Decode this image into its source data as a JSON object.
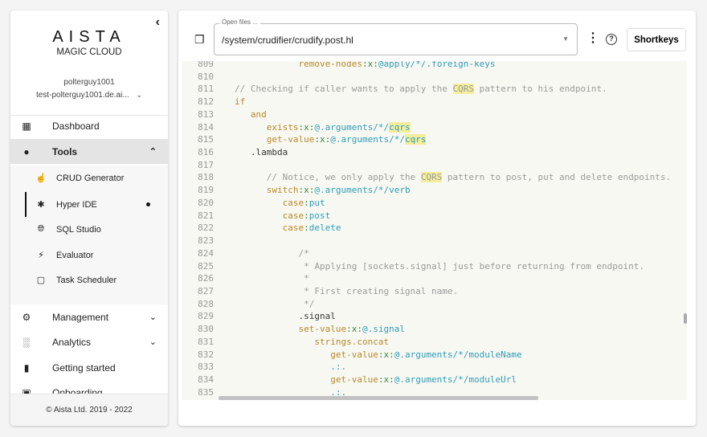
{
  "sidebar": {
    "brand": "AISTA",
    "subtitle": "MAGIC CLOUD",
    "username": "polterguy1001",
    "cloudlet": "test-polterguy1001.de.ai...",
    "nav": [
      {
        "label": "Dashboard",
        "icon": "dashboard-icon"
      },
      {
        "label": "Tools",
        "icon": "wrench-icon"
      },
      {
        "label": "Management",
        "icon": "users-gear-icon"
      },
      {
        "label": "Analytics",
        "icon": "bar-chart-icon"
      },
      {
        "label": "Getting started",
        "icon": "book-icon"
      },
      {
        "label": "Onboarding",
        "icon": "onboarding-icon"
      }
    ],
    "tools": [
      {
        "label": "CRUD Generator",
        "icon": "pointer-icon"
      },
      {
        "label": "Hyper IDE",
        "icon": "puzzle-icon"
      },
      {
        "label": "SQL Studio",
        "icon": "globe-icon"
      },
      {
        "label": "Evaluator",
        "icon": "bolt-icon"
      },
      {
        "label": "Task Scheduler",
        "icon": "calendar-icon"
      }
    ],
    "footer": "© Aista Ltd. 2019 - 2022"
  },
  "toolbar": {
    "open_files_label": "Open files ...",
    "open_file": "/system/crudifier/crudify.post.hl",
    "shortkeys": "Shortkeys"
  },
  "editor": {
    "lines": [
      {
        "n": "809",
        "t": [
          [
            "pl",
            "            "
          ],
          [
            "kw",
            "remove-nodes"
          ],
          [
            "xx",
            ":x:"
          ],
          [
            "path",
            "@apply/*/.foreign-keys"
          ]
        ]
      },
      {
        "n": "810",
        "t": []
      },
      {
        "n": "811",
        "t": [
          [
            "cm",
            "// Checking if caller wants to apply the "
          ],
          [
            "cmh",
            "CQRS"
          ],
          [
            "cm",
            " pattern to his endpoint."
          ]
        ]
      },
      {
        "n": "812",
        "t": [
          [
            "kw",
            "if"
          ]
        ]
      },
      {
        "n": "813",
        "t": [
          [
            "pl",
            "   "
          ],
          [
            "kw",
            "and"
          ]
        ]
      },
      {
        "n": "814",
        "t": [
          [
            "pl",
            "      "
          ],
          [
            "kw",
            "exists"
          ],
          [
            "xx",
            ":x:"
          ],
          [
            "path",
            "@.arguments/*/"
          ],
          [
            "pathh",
            "cqrs"
          ]
        ]
      },
      {
        "n": "815",
        "t": [
          [
            "pl",
            "      "
          ],
          [
            "kw",
            "get-value"
          ],
          [
            "xx",
            ":x:"
          ],
          [
            "path",
            "@.arguments/*/"
          ],
          [
            "pathh",
            "cqrs"
          ]
        ]
      },
      {
        "n": "816",
        "t": [
          [
            "pl",
            "   .lambda"
          ]
        ]
      },
      {
        "n": "817",
        "t": []
      },
      {
        "n": "818",
        "t": [
          [
            "pl",
            "      "
          ],
          [
            "cm",
            "// Notice, we only apply the "
          ],
          [
            "cmh",
            "CQRS"
          ],
          [
            "cm",
            " pattern to post, put and delete endpoints."
          ]
        ]
      },
      {
        "n": "819",
        "t": [
          [
            "pl",
            "      "
          ],
          [
            "kw",
            "switch"
          ],
          [
            "xx",
            ":x:"
          ],
          [
            "path",
            "@.arguments/*/verb"
          ]
        ]
      },
      {
        "n": "820",
        "t": [
          [
            "pl",
            "         "
          ],
          [
            "kw",
            "case"
          ],
          [
            "xx",
            ":"
          ],
          [
            "path",
            "put"
          ]
        ]
      },
      {
        "n": "821",
        "t": [
          [
            "pl",
            "         "
          ],
          [
            "kw",
            "case"
          ],
          [
            "xx",
            ":"
          ],
          [
            "path",
            "post"
          ]
        ]
      },
      {
        "n": "822",
        "t": [
          [
            "pl",
            "         "
          ],
          [
            "kw",
            "case"
          ],
          [
            "xx",
            ":"
          ],
          [
            "path",
            "delete"
          ]
        ]
      },
      {
        "n": "823",
        "t": []
      },
      {
        "n": "824",
        "t": [
          [
            "pl",
            "            "
          ],
          [
            "cm",
            "/*"
          ]
        ]
      },
      {
        "n": "825",
        "t": [
          [
            "pl",
            "            "
          ],
          [
            "cm",
            " * Applying [sockets.signal] just before returning from endpoint."
          ]
        ]
      },
      {
        "n": "826",
        "t": [
          [
            "pl",
            "            "
          ],
          [
            "cm",
            " *"
          ]
        ]
      },
      {
        "n": "827",
        "t": [
          [
            "pl",
            "            "
          ],
          [
            "cm",
            " * First creating signal name."
          ]
        ]
      },
      {
        "n": "828",
        "t": [
          [
            "pl",
            "            "
          ],
          [
            "cm",
            " */"
          ]
        ]
      },
      {
        "n": "829",
        "t": [
          [
            "pl",
            "            .signal"
          ]
        ]
      },
      {
        "n": "830",
        "t": [
          [
            "pl",
            "            "
          ],
          [
            "kw",
            "set-value"
          ],
          [
            "xx",
            ":x:"
          ],
          [
            "path",
            "@.signal"
          ]
        ]
      },
      {
        "n": "831",
        "t": [
          [
            "pl",
            "               "
          ],
          [
            "kw",
            "strings.concat"
          ]
        ]
      },
      {
        "n": "832",
        "t": [
          [
            "pl",
            "                  "
          ],
          [
            "kw",
            "get-value"
          ],
          [
            "xx",
            ":x:"
          ],
          [
            "path",
            "@.arguments/*/moduleName"
          ]
        ]
      },
      {
        "n": "833",
        "t": [
          [
            "pl",
            "                  "
          ],
          [
            "path",
            ".:."
          ]
        ]
      },
      {
        "n": "834",
        "t": [
          [
            "pl",
            "                  "
          ],
          [
            "kw",
            "get-value"
          ],
          [
            "xx",
            ":x:"
          ],
          [
            "path",
            "@.arguments/*/moduleUrl"
          ]
        ]
      },
      {
        "n": "835",
        "t": [
          [
            "pl",
            "                  "
          ],
          [
            "path",
            ".:."
          ]
        ]
      }
    ]
  },
  "colors": {
    "keyword": "#b5892b",
    "x": "#2f8a3e",
    "path": "#2e9cb8",
    "comment": "#9a9a9a",
    "highlight": "#f3ee9c",
    "editor_bg": "#f8f8f2"
  }
}
